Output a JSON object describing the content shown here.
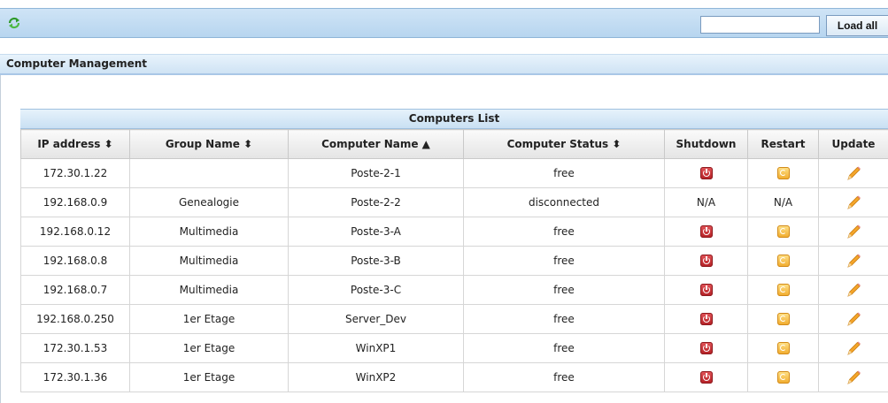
{
  "toolbar": {
    "search_value": "",
    "load_all_label": "Load all",
    "refresh_icon": "refresh-icon"
  },
  "section_title": "Computer Management",
  "table": {
    "caption": "Computers List",
    "headers": {
      "ip": "IP address ⬍",
      "group": "Group Name ⬍",
      "name": "Computer Name ▲",
      "status": "Computer Status ⬍",
      "shutdown": "Shutdown",
      "restart": "Restart",
      "update": "Update"
    },
    "rows": [
      {
        "ip": "172.30.1.22",
        "group": "",
        "name": "Poste-2-1",
        "status": "free",
        "shutdown": "",
        "restart": ""
      },
      {
        "ip": "192.168.0.9",
        "group": "Genealogie",
        "name": "Poste-2-2",
        "status": "disconnected",
        "shutdown": "N/A",
        "restart": "N/A"
      },
      {
        "ip": "192.168.0.12",
        "group": "Multimedia",
        "name": "Poste-3-A",
        "status": "free",
        "shutdown": "",
        "restart": ""
      },
      {
        "ip": "192.168.0.8",
        "group": "Multimedia",
        "name": "Poste-3-B",
        "status": "free",
        "shutdown": "",
        "restart": ""
      },
      {
        "ip": "192.168.0.7",
        "group": "Multimedia",
        "name": "Poste-3-C",
        "status": "free",
        "shutdown": "",
        "restart": ""
      },
      {
        "ip": "192.168.0.250",
        "group": "1er Etage",
        "name": "Server_Dev",
        "status": "free",
        "shutdown": "",
        "restart": ""
      },
      {
        "ip": "172.30.1.53",
        "group": "1er Etage",
        "name": "WinXP1",
        "status": "free",
        "shutdown": "",
        "restart": ""
      },
      {
        "ip": "172.30.1.36",
        "group": "1er Etage",
        "name": "WinXP2",
        "status": "free",
        "shutdown": "",
        "restart": ""
      }
    ]
  },
  "colors": {
    "toolbar_bg": "#c6def3",
    "shutdown_icon": "#c8282e",
    "restart_icon": "#f7c14a",
    "update_icon": "#f0a020"
  }
}
